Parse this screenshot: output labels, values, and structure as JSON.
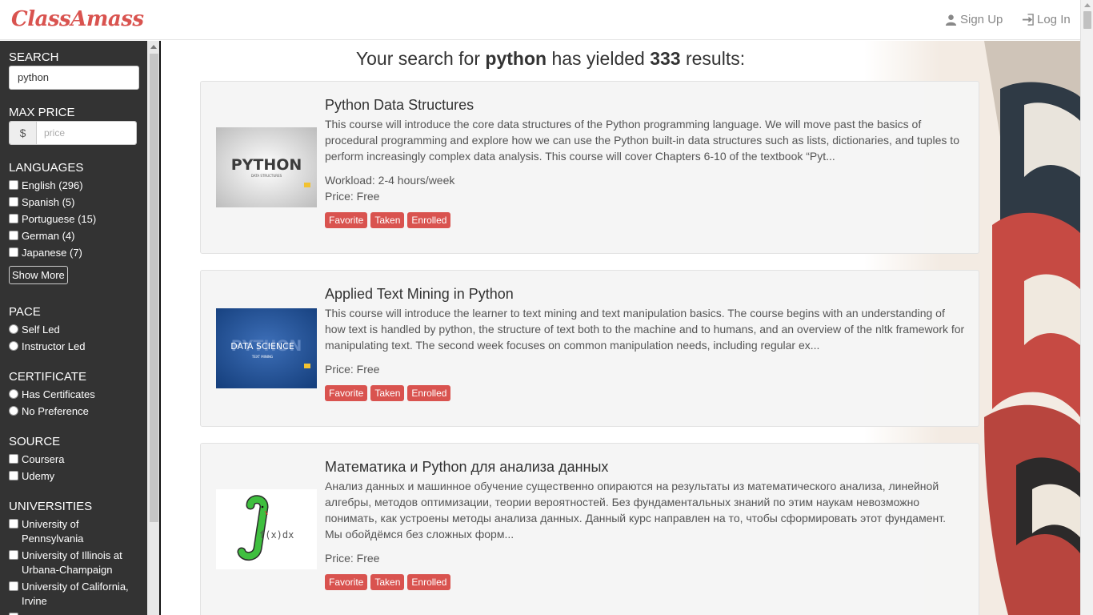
{
  "header": {
    "logo": "ClassAmass",
    "signup": "Sign Up",
    "login": "Log In"
  },
  "sidebar": {
    "search_title": "SEARCH",
    "search_value": "python",
    "max_price_title": "MAX PRICE",
    "currency": "$",
    "price_placeholder": "price",
    "languages_title": "LANGUAGES",
    "languages": [
      "English (296)",
      "Spanish (5)",
      "Portuguese (15)",
      "German (4)",
      "Japanese (7)"
    ],
    "show_more": "Show More",
    "pace_title": "PACE",
    "pace": [
      "Self Led",
      "Instructor Led"
    ],
    "certificate_title": "CERTIFICATE",
    "certificate": [
      "Has Certificates",
      "No Preference"
    ],
    "source_title": "SOURCE",
    "source": [
      "Coursera",
      "Udemy"
    ],
    "universities_title": "UNIVERSITIES",
    "universities": [
      "University of Pennsylvania",
      "University of Illinois at Urbana-Champaign",
      "University of California, Irvine"
    ]
  },
  "results": {
    "prefix": "Your search for",
    "query": "python",
    "middle": "has yielded",
    "count": "333",
    "suffix": "results:"
  },
  "courses": [
    {
      "title": "Python Data Structures",
      "description": "This course will introduce the core data structures of the Python programming language. We will move past the basics of procedural programming and explore how we can use the Python built-in data structures such as lists, dictionaries, and tuples to perform increasingly complex data analysis. This course will cover Chapters 6-10 of the textbook “Pyt...",
      "workload": "Workload: 2-4 hours/week",
      "price": "Price: Free",
      "thumb_text": "PYTHON",
      "thumb_sub": "DATA STRUCTURES"
    },
    {
      "title": "Applied Text Mining in Python",
      "description": "This course will introduce the learner to text mining and text manipulation basics. The course begins with an understanding of how text is handled by python, the structure of text both to the machine and to humans, and an overview of the nltk framework for manipulating text. The second week focuses on common manipulation needs, including regular ex...",
      "price": "Price: Free",
      "thumb_text": "DATA SCIENCE",
      "thumb_sub": "TEXT MINING"
    },
    {
      "title": "Математика и Python для анализа данных",
      "description": "Анализ данных и машинное обучение существенно опираются на результаты из математического анализа, линейной алгебры, методов оптимизации, теории вероятностей. Без фундаментальных знаний по этим наукам невозможно понимать, как устроены методы анализа данных. Данный курс направлен на то, чтобы сформировать этот фундамент. Мы обойдёмся без сложных форм...",
      "price": "Price: Free",
      "thumb_text": "f(x)dx"
    }
  ],
  "buttons": {
    "favorite": "Favorite",
    "taken": "Taken",
    "enrolled": "Enrolled"
  },
  "colors": {
    "accent": "#d9534f",
    "sidebar_bg": "#333333"
  }
}
